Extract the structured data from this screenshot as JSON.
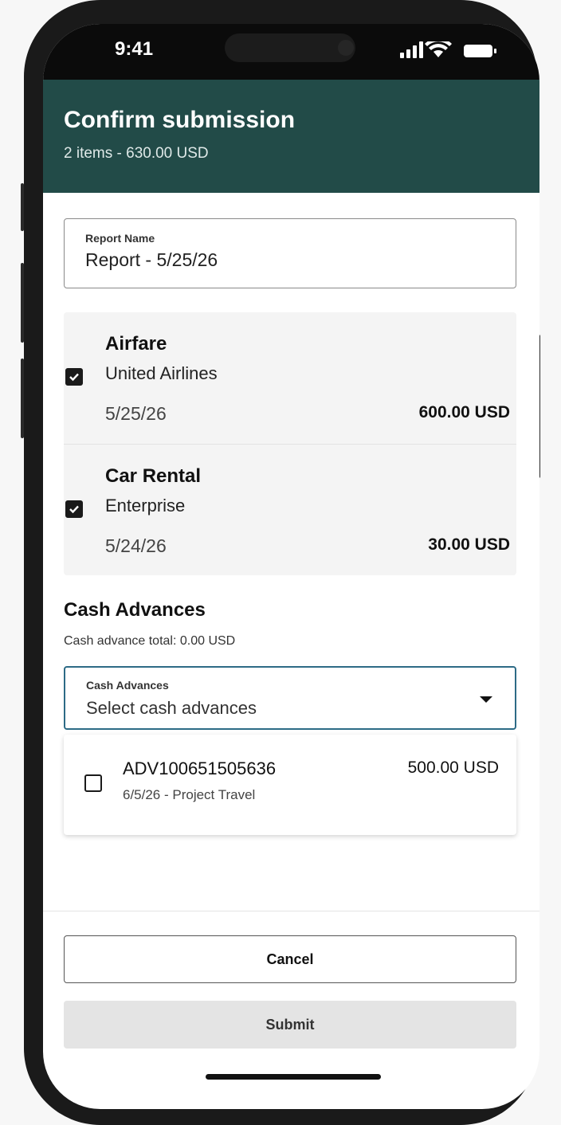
{
  "status_bar": {
    "time": "9:41",
    "icons": [
      "signal-icon",
      "wifi-icon",
      "battery-icon"
    ]
  },
  "header": {
    "title": "Confirm submission",
    "subtitle": "2 items - 630.00 USD",
    "background": "#224b48"
  },
  "report_name": {
    "label": "Report Name",
    "value": "Report - 5/25/26"
  },
  "items": [
    {
      "category": "Airfare",
      "merchant": "United Airlines",
      "date": "5/25/26",
      "amount": "600.00 USD",
      "checked": true
    },
    {
      "category": "Car Rental",
      "merchant": "Enterprise",
      "date": "5/24/26",
      "amount": "30.00 USD",
      "checked": true
    }
  ],
  "cash_advances": {
    "section_title": "Cash Advances",
    "total_text": "Cash advance total: 0.00 USD",
    "select_label": "Cash Advances",
    "select_placeholder": "Select cash advances",
    "options": [
      {
        "id": "ADV100651505636",
        "description": "6/5/26 - Project Travel",
        "amount": "500.00 USD",
        "checked": false
      }
    ]
  },
  "actions": {
    "cancel_label": "Cancel",
    "submit_label": "Submit"
  }
}
